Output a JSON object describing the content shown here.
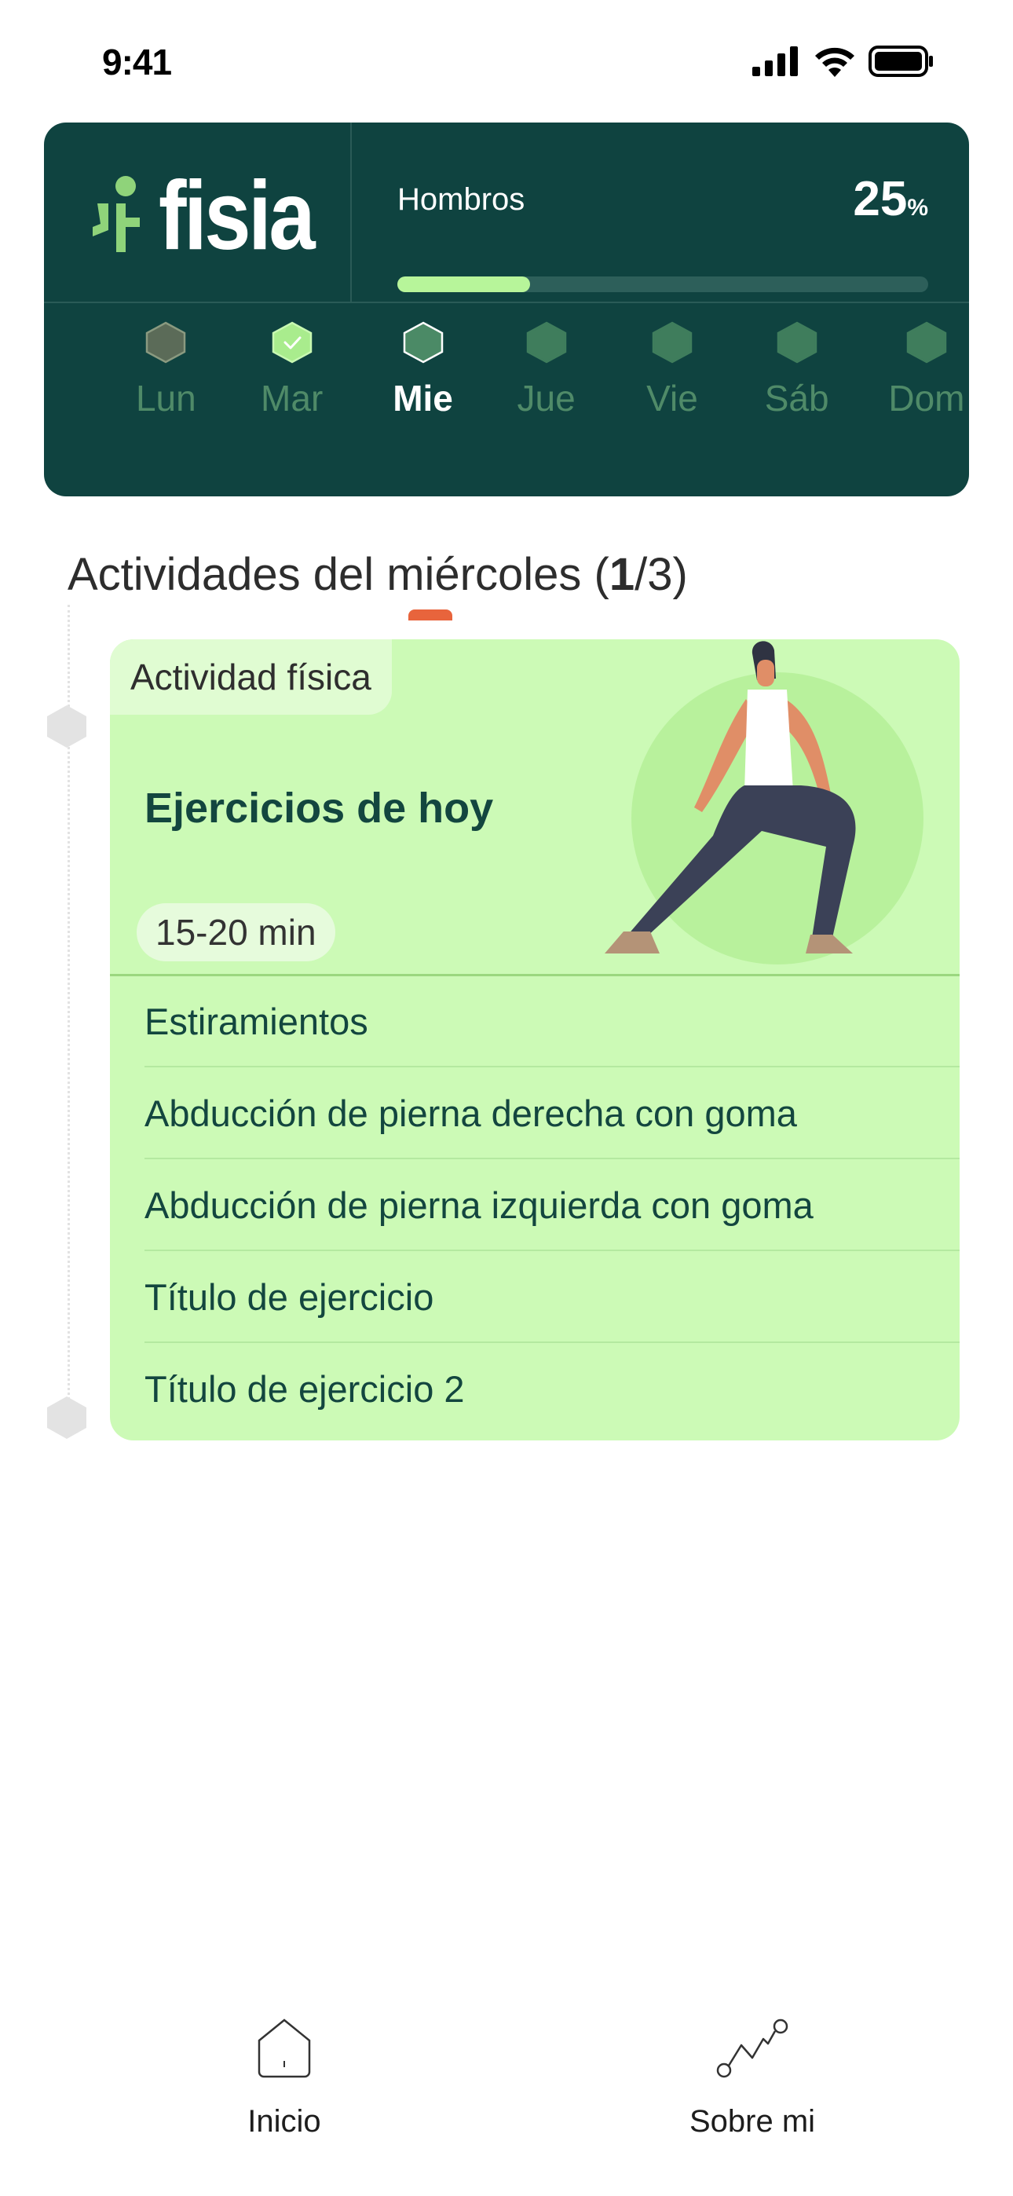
{
  "status_bar": {
    "time": "9:41",
    "icons": [
      "signal-icon",
      "wifi-icon",
      "battery-icon"
    ]
  },
  "header": {
    "logo_text": "fisia",
    "progress": {
      "label": "Hombros",
      "value": "25",
      "unit": "%",
      "fraction": 0.25
    },
    "days": [
      {
        "label": "Lun",
        "state": "missed"
      },
      {
        "label": "Mar",
        "state": "completed"
      },
      {
        "label": "Mie",
        "state": "selected"
      },
      {
        "label": "Jue",
        "state": "upcoming"
      },
      {
        "label": "Vie",
        "state": "upcoming"
      },
      {
        "label": "Sáb",
        "state": "upcoming"
      },
      {
        "label": "Dom",
        "state": "upcoming"
      }
    ]
  },
  "section": {
    "title_prefix": "Actividades del miércoles (",
    "current": "1",
    "title_suffix": "/3)"
  },
  "activity": {
    "tag": "Actividad física",
    "title": "Ejercicios de hoy",
    "duration": "15-20 min",
    "exercises": [
      "Estiramientos",
      "Abducción de pierna derecha con goma",
      "Abducción de pierna izquierda con goma",
      "Título de ejercicio",
      "Título de ejercicio 2"
    ]
  },
  "bottom_nav": {
    "items": [
      {
        "label": "Inicio",
        "icon": "home-icon"
      },
      {
        "label": "Sobre mi",
        "icon": "chart-line-icon"
      }
    ]
  },
  "colors": {
    "brand_dark": "#0f4340",
    "accent_green": "#b7f59a",
    "card_green": "#ccfab6",
    "selected_indicator": "#e8643c"
  }
}
